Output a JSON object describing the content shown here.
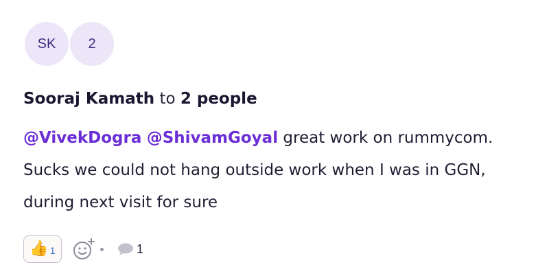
{
  "avatars": [
    {
      "initials": "SK"
    },
    {
      "initials": "2"
    }
  ],
  "post": {
    "author": "Sooraj Kamath",
    "to_word": "to",
    "recipients": "2 people",
    "mentions": [
      "@VivekDogra",
      "@ShivamGoyal"
    ],
    "message_lines": [
      "great work on rummycom.",
      "Sucks we could not hang outside work when I was in GGN,",
      "during next visit for sure"
    ]
  },
  "actions": {
    "reaction_icon": "thumbs-up-icon",
    "reaction_count": "1",
    "add_reaction_icon": "add-emoji-icon",
    "comment_icon": "comment-bubble-icon",
    "comment_count": "1"
  },
  "colors": {
    "mention": "#6b2ed6",
    "avatar_bg": "#ece6f8",
    "avatar_text": "#3a2c86",
    "reaction_count": "#3a6fd1"
  }
}
